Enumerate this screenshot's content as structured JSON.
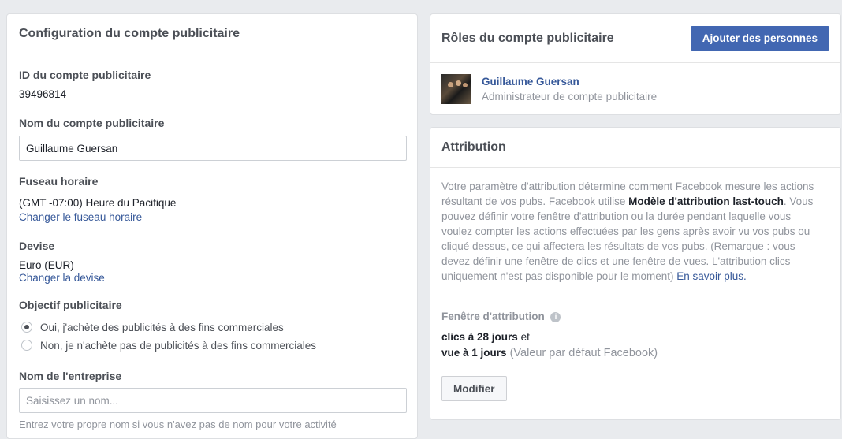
{
  "left_panel": {
    "title": "Configuration du compte publicitaire",
    "account_id": {
      "label": "ID du compte publicitaire",
      "value": "39496814"
    },
    "account_name": {
      "label": "Nom du compte publicitaire",
      "value": "Guillaume Guersan"
    },
    "timezone": {
      "label": "Fuseau horaire",
      "value": "(GMT -07:00) Heure du Pacifique",
      "change_link": "Changer le fuseau horaire"
    },
    "currency": {
      "label": "Devise",
      "value": "Euro (EUR)",
      "change_link": "Changer la devise"
    },
    "objective": {
      "label": "Objectif publicitaire",
      "options": [
        {
          "label": "Oui, j'achète des publicités à des fins commerciales",
          "checked": true
        },
        {
          "label": "Non, je n'achète pas de publicités à des fins commerciales",
          "checked": false
        }
      ]
    },
    "business_name": {
      "label": "Nom de l'entreprise",
      "placeholder": "Saisissez un nom...",
      "help": "Entrez votre propre nom si vous n'avez pas de nom pour votre activité"
    }
  },
  "roles_panel": {
    "title": "Rôles du compte publicitaire",
    "add_button": "Ajouter des personnes",
    "person": {
      "name": "Guillaume Guersan",
      "role": "Administrateur de compte publicitaire",
      "avatar_icon": "user-photo-icon"
    }
  },
  "attribution_panel": {
    "title": "Attribution",
    "description_1": "Votre paramètre d'attribution détermine comment Facebook mesure les actions résultant de vos pubs. Facebook utilise ",
    "description_bold": "Modèle d'attribution last-touch",
    "description_2": ". Vous pouvez définir votre fenêtre d'attribution ou la durée pendant laquelle vous voulez compter les actions effectuées par les gens après avoir vu vos pubs ou cliqué dessus, ce qui affectera les résultats de vos pubs. (Remarque : vous devez définir une fenêtre de clics et une fenêtre de vues. L'attribution clics uniquement n'est pas disponible pour le moment) ",
    "learn_more": "En savoir plus.",
    "window_label": "Fenêtre d'attribution",
    "info_icon": "i",
    "clicks_value": "clics à 28 jours",
    "clicks_suffix": " et",
    "views_value": "vue à 1 jours",
    "views_suffix": " (Valeur par défaut Facebook)",
    "modify_button": "Modifier"
  }
}
